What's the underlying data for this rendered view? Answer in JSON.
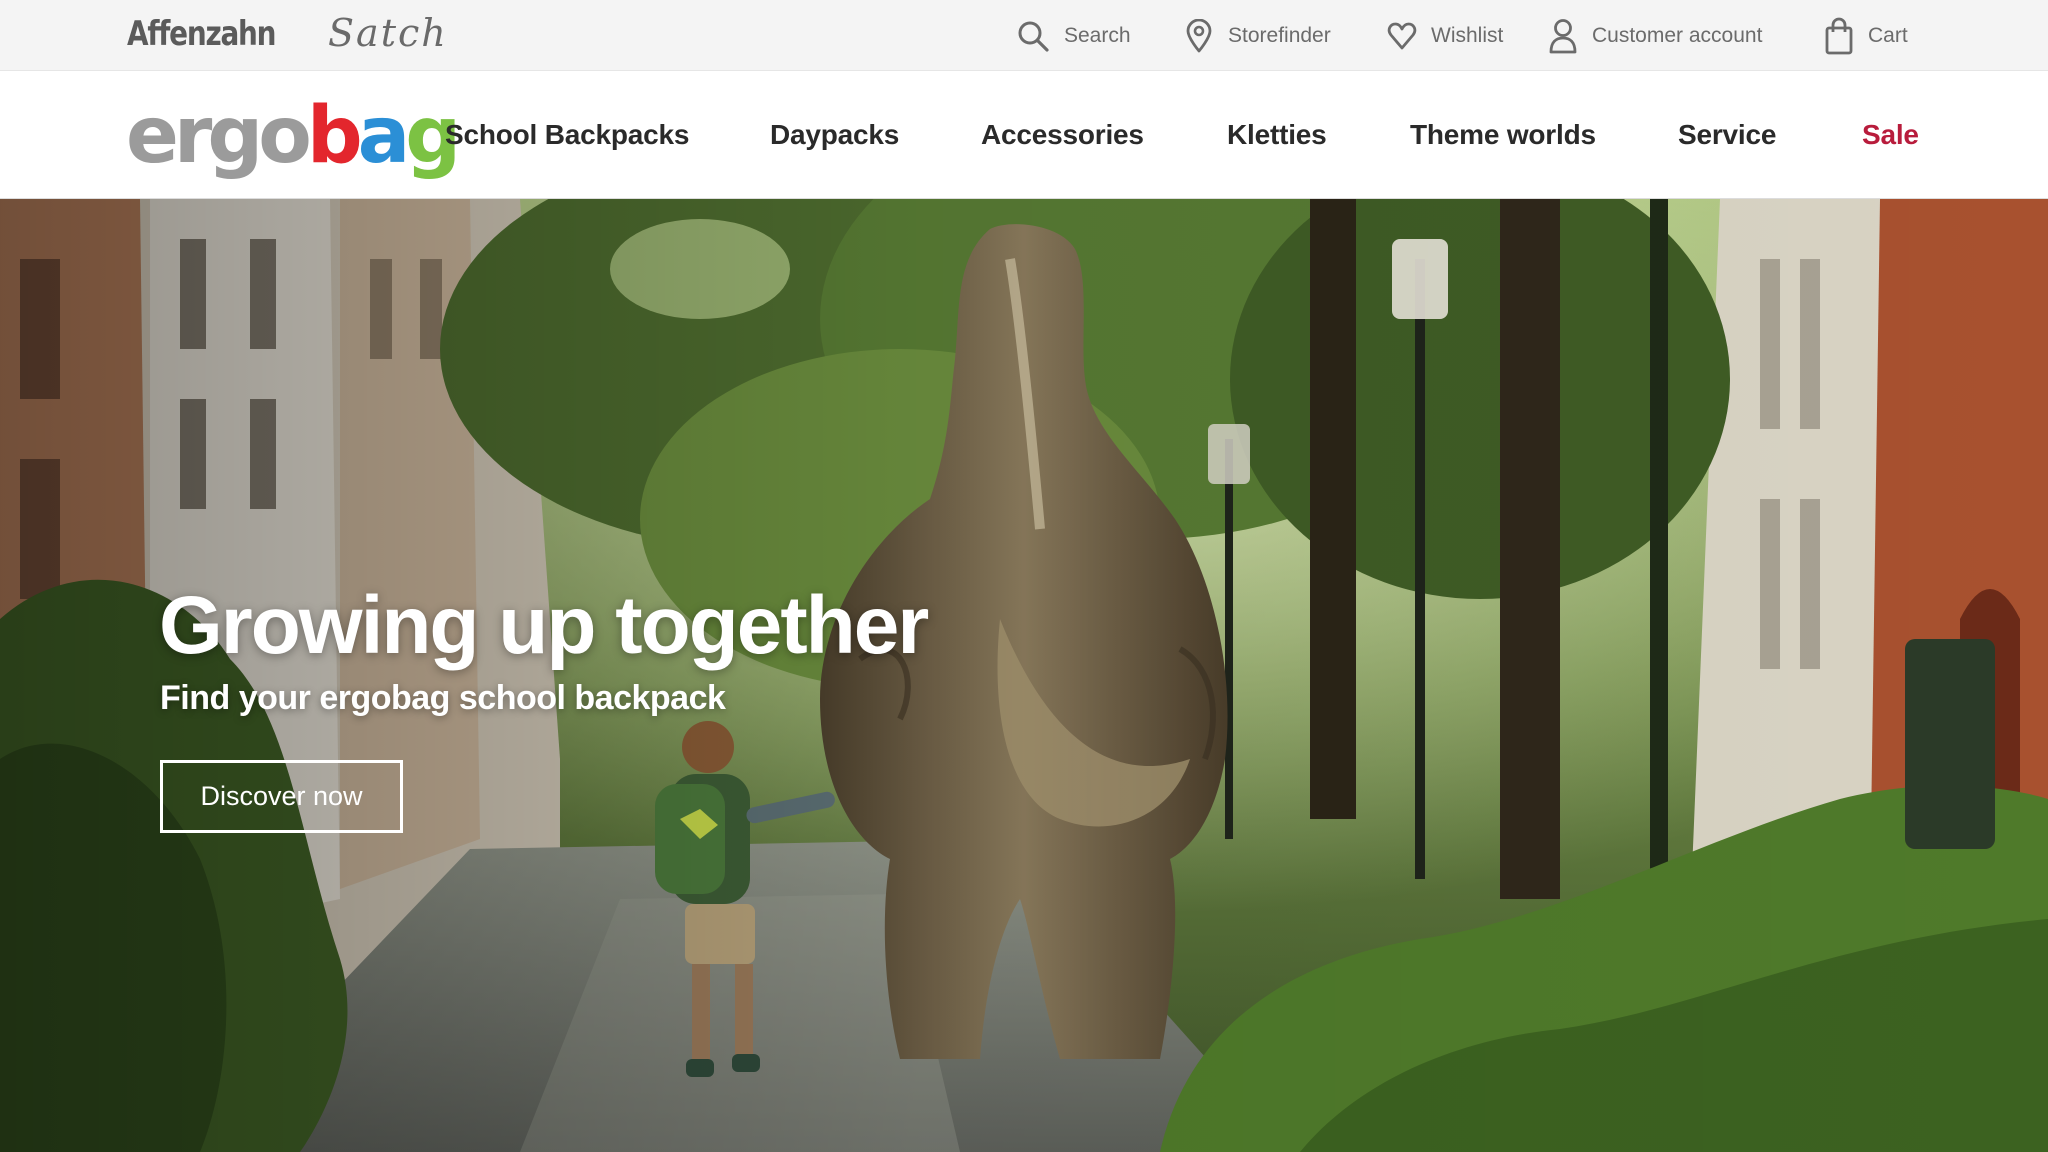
{
  "topbar": {
    "brands": [
      "Affenzahn",
      "Satch"
    ],
    "utilities": [
      {
        "label": "Search",
        "icon": "search-icon"
      },
      {
        "label": "Storefinder",
        "icon": "location-pin-icon"
      },
      {
        "label": "Wishlist",
        "icon": "heart-icon"
      },
      {
        "label": "Customer account",
        "icon": "user-icon"
      },
      {
        "label": "Cart",
        "icon": "shopping-bag-icon"
      }
    ]
  },
  "logo": {
    "letters": [
      "e",
      "r",
      "g",
      "o",
      "b",
      "a",
      "g"
    ],
    "colors": [
      "#9b9b9b",
      "#9b9b9b",
      "#9b9b9b",
      "#9b9b9b",
      "#e3262d",
      "#2b8fd6",
      "#7cc243"
    ]
  },
  "nav": {
    "items": [
      "School Backpacks",
      "Daypacks",
      "Accessories",
      "Kletties",
      "Theme worlds",
      "Service",
      "Sale"
    ],
    "sale_color": "#b81c3c"
  },
  "hero": {
    "title": "Growing up together",
    "subtitle": "Find your ergobag school backpack",
    "cta": "Discover now"
  }
}
